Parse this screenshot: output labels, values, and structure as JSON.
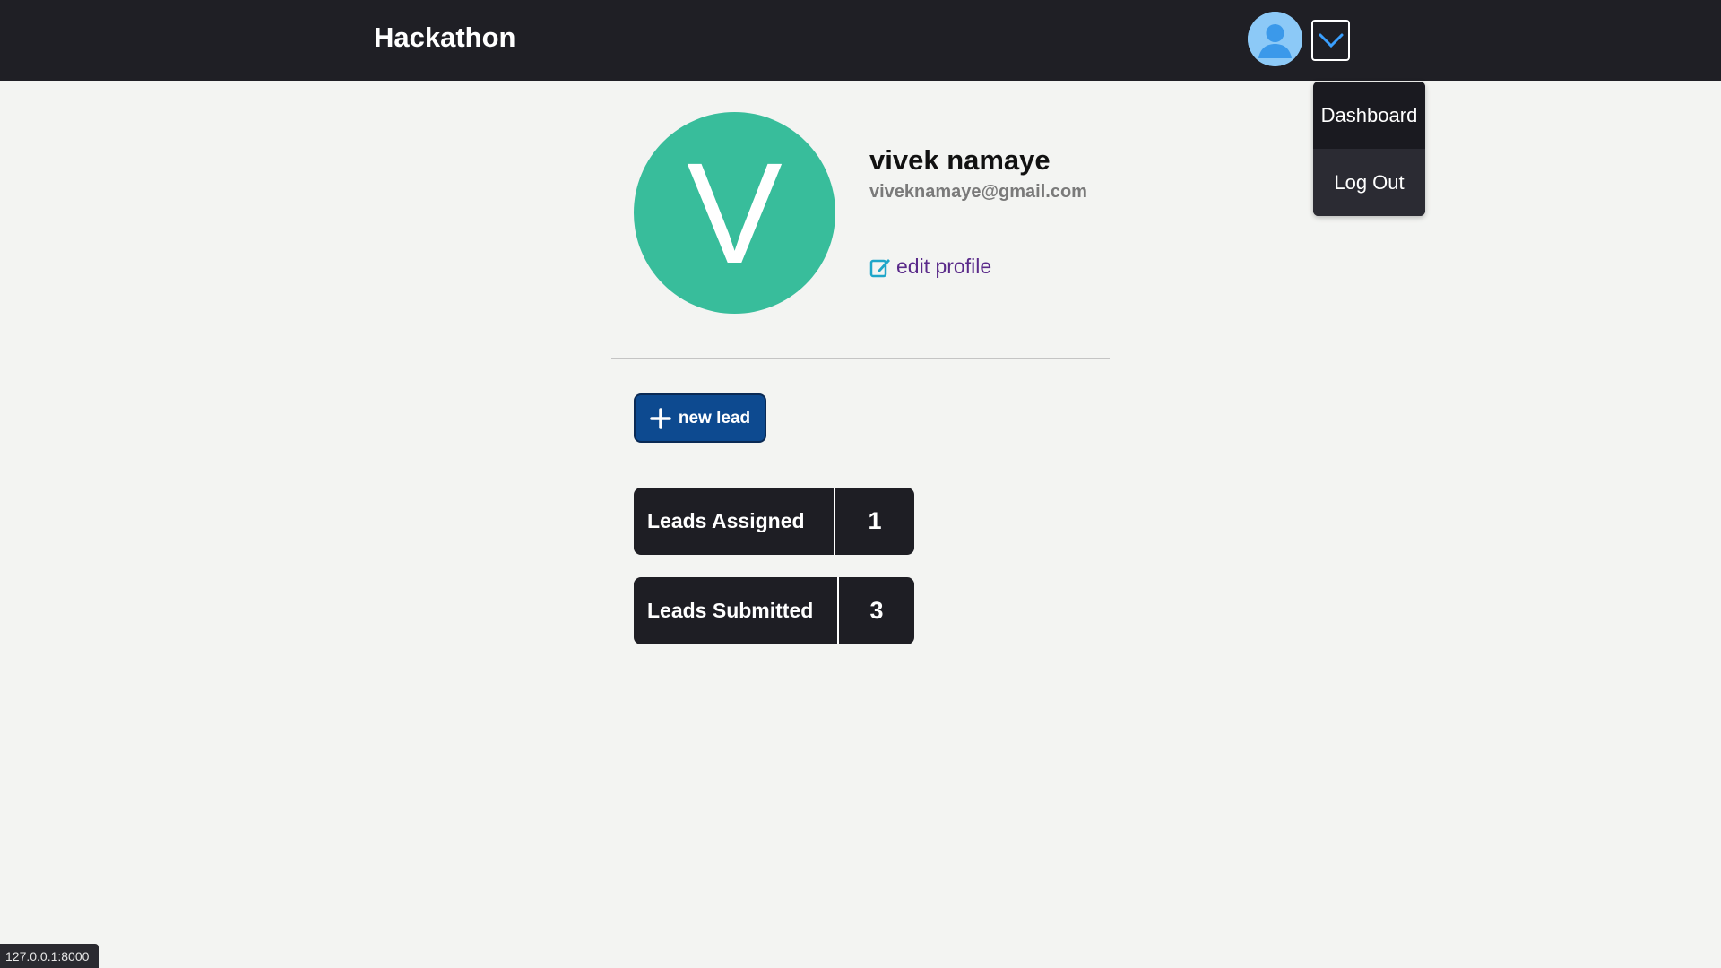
{
  "navbar": {
    "brand": "Hackathon",
    "avatar_icon": "user-avatar-icon",
    "toggle_icon": "chevron-down-icon"
  },
  "dropdown": {
    "items": [
      {
        "label": "Dashboard"
      },
      {
        "label": "Log Out"
      }
    ]
  },
  "profile": {
    "initial": "V",
    "name": "vivek namaye",
    "email": "viveknamaye@gmail.com",
    "edit_label": "edit profile",
    "edit_icon": "edit-icon",
    "avatar_color": "#38bd9b"
  },
  "actions": {
    "new_lead_label": "new lead",
    "new_lead_icon": "plus-icon"
  },
  "stats": [
    {
      "label": "Leads Assigned",
      "value": "1"
    },
    {
      "label": "Leads Submitted",
      "value": "3"
    }
  ],
  "status_bar": {
    "url": "127.0.0.1:8000"
  },
  "colors": {
    "navbar": "#1f1f25",
    "primary_button": "#0d4a90",
    "background": "#f3f4f2"
  }
}
